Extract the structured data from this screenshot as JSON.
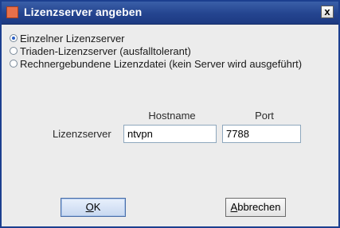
{
  "dialog": {
    "title": "Lizenzserver angeben",
    "close_label": "x"
  },
  "options": [
    {
      "label": "Einzelner Lizenzserver",
      "checked": true
    },
    {
      "label": "Triaden-Lizenzserver (ausfalltolerant)",
      "checked": false
    },
    {
      "label": "Rechnergebundene Lizenzdatei (kein Server wird ausgeführt)",
      "checked": false
    }
  ],
  "server": {
    "hostname_header": "Hostname",
    "port_header": "Port",
    "row_label": "Lizenzserver",
    "hostname_value": "ntvpn",
    "port_value": "7788"
  },
  "buttons": {
    "ok_mnemonic": "O",
    "ok_rest": "K",
    "cancel_mnemonic": "A",
    "cancel_rest": "bbrechen"
  },
  "colors": {
    "titlebar": "#24448f",
    "radio_selected": "#2a5fc4"
  }
}
